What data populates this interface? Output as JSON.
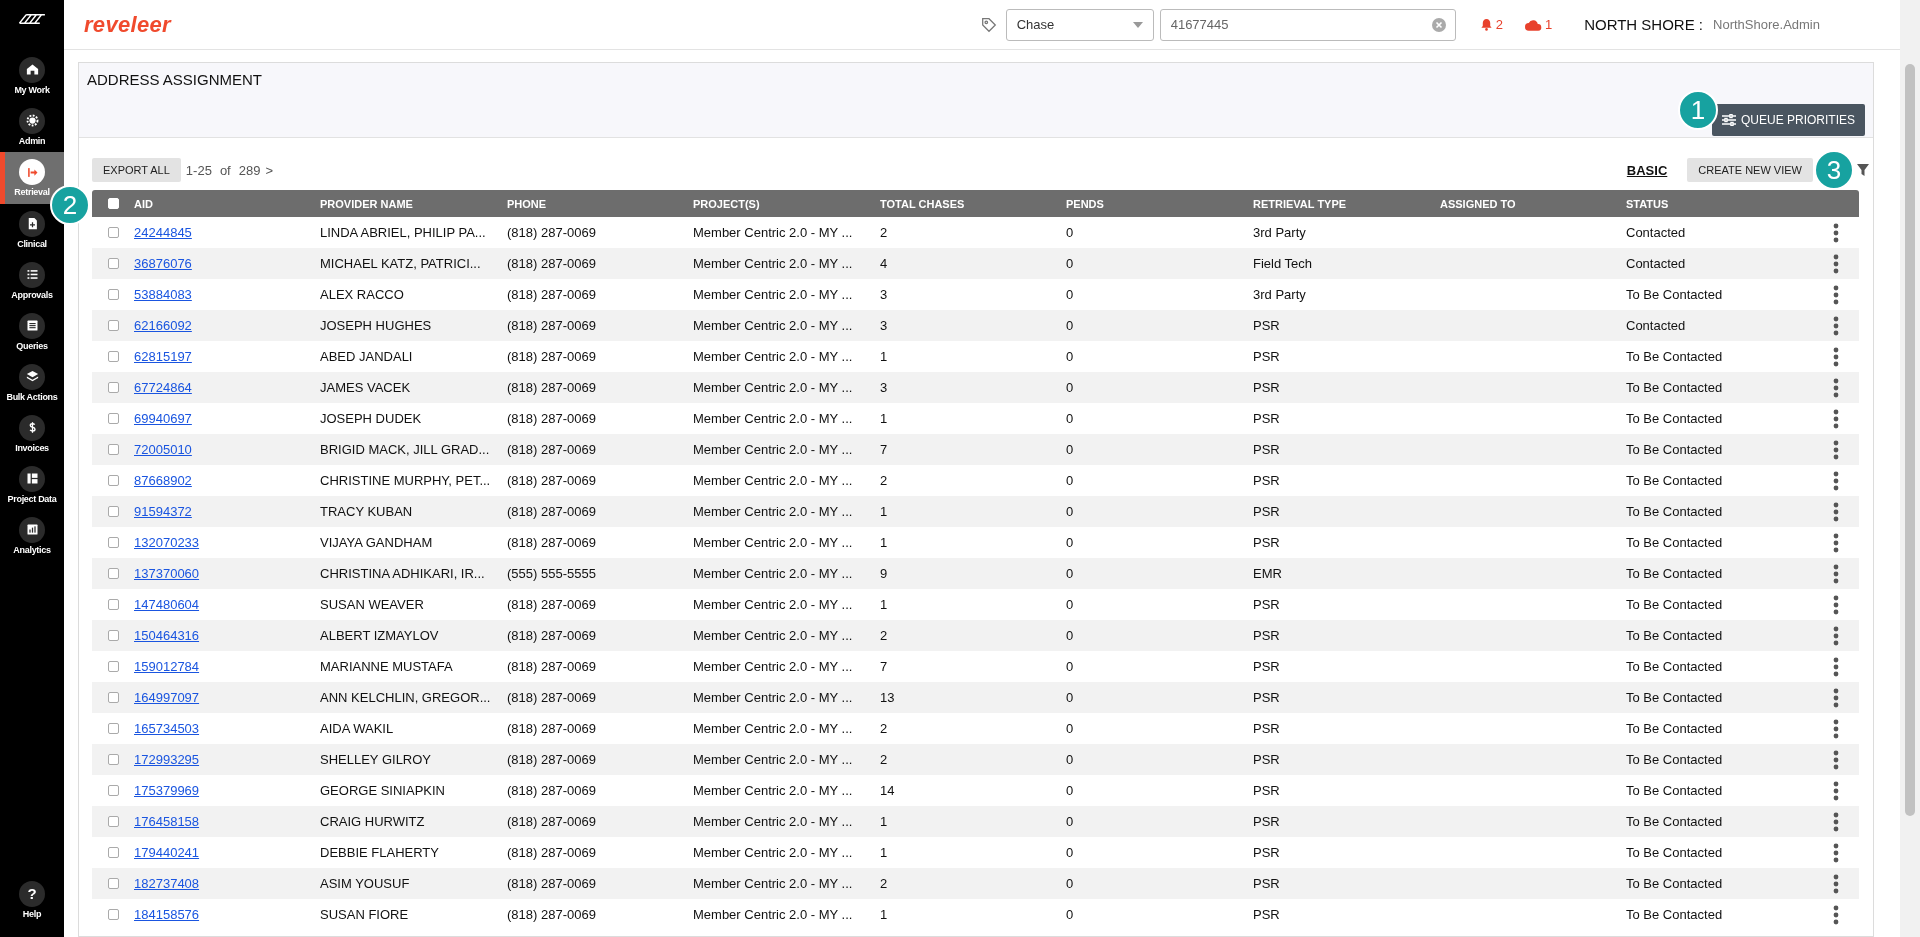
{
  "sidebar": {
    "items": [
      {
        "label": "My Work",
        "selected": false
      },
      {
        "label": "Admin",
        "selected": false
      },
      {
        "label": "Retrieval",
        "selected": true
      },
      {
        "label": "Clinical",
        "selected": false
      },
      {
        "label": "Approvals",
        "selected": false
      },
      {
        "label": "Queries",
        "selected": false
      },
      {
        "label": "Bulk Actions",
        "selected": false
      },
      {
        "label": "Invoices",
        "selected": false
      },
      {
        "label": "Project Data",
        "selected": false
      },
      {
        "label": "Analytics",
        "selected": false
      }
    ],
    "help": {
      "label": "Help",
      "icon": "?"
    }
  },
  "header": {
    "logo": "reveleer",
    "search_type": "Chase",
    "search_value": "41677445",
    "alerts": "2",
    "cloud_alerts": "1",
    "org": "NORTH SHORE :",
    "user": "NorthShore.Admin"
  },
  "page": {
    "title": "ADDRESS ASSIGNMENT",
    "queue_button": "QUEUE PRIORITIES",
    "export_button": "EXPORT ALL",
    "range": "1-25",
    "of": "of",
    "total": "289",
    "next": ">",
    "view_link": "BASIC",
    "create_view_button": "CREATE NEW VIEW"
  },
  "table": {
    "select_all_checked": false,
    "columns": [
      "AID",
      "PROVIDER NAME",
      "PHONE",
      "PROJECT(S)",
      "TOTAL CHASES",
      "PENDS",
      "RETRIEVAL TYPE",
      "ASSIGNED TO",
      "STATUS"
    ],
    "rows": [
      {
        "aid": "24244845",
        "provider": "LINDA ABRIEL, PHILIP PA...",
        "phone": "(818) 287-0069",
        "project": "Member Centric 2.0 - MY ...",
        "total": "2",
        "pends": "0",
        "type": "3rd Party",
        "status": "Contacted",
        "checked": false
      },
      {
        "aid": "36876076",
        "provider": "MICHAEL KATZ, PATRICI...",
        "phone": "(818) 287-0069",
        "project": "Member Centric 2.0 - MY ...",
        "total": "4",
        "pends": "0",
        "type": "Field Tech",
        "status": "Contacted",
        "checked": false
      },
      {
        "aid": "53884083",
        "provider": "ALEX RACCO",
        "phone": "(818) 287-0069",
        "project": "Member Centric 2.0 - MY ...",
        "total": "3",
        "pends": "0",
        "type": "3rd Party",
        "status": "To Be Contacted",
        "checked": false
      },
      {
        "aid": "62166092",
        "provider": "JOSEPH HUGHES",
        "phone": "(818) 287-0069",
        "project": "Member Centric 2.0 - MY ...",
        "total": "3",
        "pends": "0",
        "type": "PSR",
        "status": "Contacted",
        "checked": false
      },
      {
        "aid": "62815197",
        "provider": "ABED JANDALI",
        "phone": "(818) 287-0069",
        "project": "Member Centric 2.0 - MY ...",
        "total": "1",
        "pends": "0",
        "type": "PSR",
        "status": "To Be Contacted",
        "checked": false
      },
      {
        "aid": "67724864",
        "provider": "JAMES VACEK",
        "phone": "(818) 287-0069",
        "project": "Member Centric 2.0 - MY ...",
        "total": "3",
        "pends": "0",
        "type": "PSR",
        "status": "To Be Contacted",
        "checked": false
      },
      {
        "aid": "69940697",
        "provider": "JOSEPH DUDEK",
        "phone": "(818) 287-0069",
        "project": "Member Centric 2.0 - MY ...",
        "total": "1",
        "pends": "0",
        "type": "PSR",
        "status": "To Be Contacted",
        "checked": false
      },
      {
        "aid": "72005010",
        "provider": "BRIGID MACK, JILL GRAD...",
        "phone": "(818) 287-0069",
        "project": "Member Centric 2.0 - MY ...",
        "total": "7",
        "pends": "0",
        "type": "PSR",
        "status": "To Be Contacted",
        "checked": false
      },
      {
        "aid": "87668902",
        "provider": "CHRISTINE MURPHY, PET...",
        "phone": "(818) 287-0069",
        "project": "Member Centric 2.0 - MY ...",
        "total": "2",
        "pends": "0",
        "type": "PSR",
        "status": "To Be Contacted",
        "checked": false
      },
      {
        "aid": "91594372",
        "provider": "TRACY KUBAN",
        "phone": "(818) 287-0069",
        "project": "Member Centric 2.0 - MY ...",
        "total": "1",
        "pends": "0",
        "type": "PSR",
        "status": "To Be Contacted",
        "checked": false
      },
      {
        "aid": "132070233",
        "provider": "VIJAYA GANDHAM",
        "phone": "(818) 287-0069",
        "project": "Member Centric 2.0 - MY ...",
        "total": "1",
        "pends": "0",
        "type": "PSR",
        "status": "To Be Contacted",
        "checked": false
      },
      {
        "aid": "137370060",
        "provider": "CHRISTINA ADHIKARI, IR...",
        "phone": "(555) 555-5555",
        "project": "Member Centric 2.0 - MY ...",
        "total": "9",
        "pends": "0",
        "type": "EMR",
        "status": "To Be Contacted",
        "checked": false
      },
      {
        "aid": "147480604",
        "provider": "SUSAN WEAVER",
        "phone": "(818) 287-0069",
        "project": "Member Centric 2.0 - MY ...",
        "total": "1",
        "pends": "0",
        "type": "PSR",
        "status": "To Be Contacted",
        "checked": false
      },
      {
        "aid": "150464316",
        "provider": "ALBERT IZMAYLOV",
        "phone": "(818) 287-0069",
        "project": "Member Centric 2.0 - MY ...",
        "total": "2",
        "pends": "0",
        "type": "PSR",
        "status": "To Be Contacted",
        "checked": false
      },
      {
        "aid": "159012784",
        "provider": "MARIANNE MUSTAFA",
        "phone": "(818) 287-0069",
        "project": "Member Centric 2.0 - MY ...",
        "total": "7",
        "pends": "0",
        "type": "PSR",
        "status": "To Be Contacted",
        "checked": false
      },
      {
        "aid": "164997097",
        "provider": "ANN KELCHLIN, GREGOR...",
        "phone": "(818) 287-0069",
        "project": "Member Centric 2.0 - MY ...",
        "total": "13",
        "pends": "0",
        "type": "PSR",
        "status": "To Be Contacted",
        "checked": false
      },
      {
        "aid": "165734503",
        "provider": "AIDA WAKIL",
        "phone": "(818) 287-0069",
        "project": "Member Centric 2.0 - MY ...",
        "total": "2",
        "pends": "0",
        "type": "PSR",
        "status": "To Be Contacted",
        "checked": false
      },
      {
        "aid": "172993295",
        "provider": "SHELLEY GILROY",
        "phone": "(818) 287-0069",
        "project": "Member Centric 2.0 - MY ...",
        "total": "2",
        "pends": "0",
        "type": "PSR",
        "status": "To Be Contacted",
        "checked": false
      },
      {
        "aid": "175379969",
        "provider": "GEORGE SINIAPKIN",
        "phone": "(818) 287-0069",
        "project": "Member Centric 2.0 - MY ...",
        "total": "14",
        "pends": "0",
        "type": "PSR",
        "status": "To Be Contacted",
        "checked": false
      },
      {
        "aid": "176458158",
        "provider": "CRAIG HURWITZ",
        "phone": "(818) 287-0069",
        "project": "Member Centric 2.0 - MY ...",
        "total": "1",
        "pends": "0",
        "type": "PSR",
        "status": "To Be Contacted",
        "checked": false
      },
      {
        "aid": "179440241",
        "provider": "DEBBIE FLAHERTY",
        "phone": "(818) 287-0069",
        "project": "Member Centric 2.0 - MY ...",
        "total": "1",
        "pends": "0",
        "type": "PSR",
        "status": "To Be Contacted",
        "checked": false
      },
      {
        "aid": "182737408",
        "provider": "ASIM YOUSUF",
        "phone": "(818) 287-0069",
        "project": "Member Centric 2.0 - MY ...",
        "total": "2",
        "pends": "0",
        "type": "PSR",
        "status": "To Be Contacted",
        "checked": false
      },
      {
        "aid": "184158576",
        "provider": "SUSAN FIORE",
        "phone": "(818) 287-0069",
        "project": "Member Centric 2.0 - MY ...",
        "total": "1",
        "pends": "0",
        "type": "PSR",
        "status": "To Be Contacted",
        "checked": false
      }
    ]
  },
  "callouts": [
    {
      "number": "1"
    },
    {
      "number": "2"
    },
    {
      "number": "3"
    }
  ]
}
